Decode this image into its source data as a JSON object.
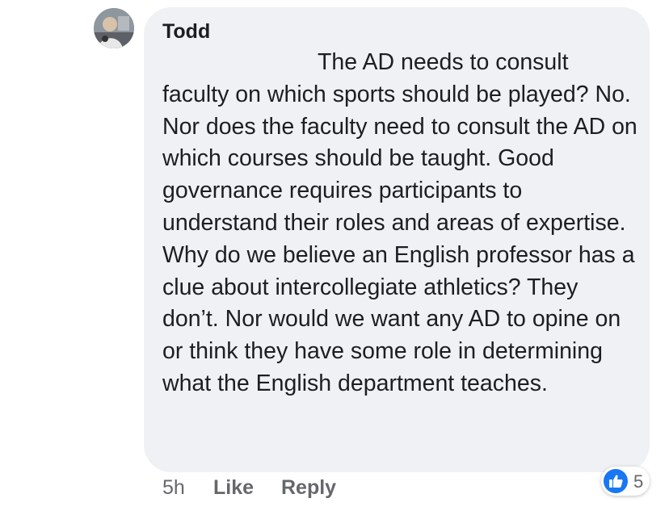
{
  "comment": {
    "author": "Todd",
    "text": "The AD needs to consult faculty on which sports should be played? No. Nor does the faculty need to consult the AD on which courses should be taught. Good governance requires participants to understand their roles and areas of expertise. Why do we believe an English professor has a clue about intercollegiate athletics? They don’t. Nor would we want any AD to opine on or think they have some role in determining what the English department teaches.",
    "time": "5h",
    "like_label": "Like",
    "reply_label": "Reply",
    "reaction_count": "5"
  },
  "icons": {
    "avatar": "profile-photo",
    "reaction": "thumbs-up-icon"
  },
  "colors": {
    "bubble": "#eff1f4",
    "text": "#1c1e21",
    "meta": "#65676b",
    "like_blue": "#1877f2"
  }
}
